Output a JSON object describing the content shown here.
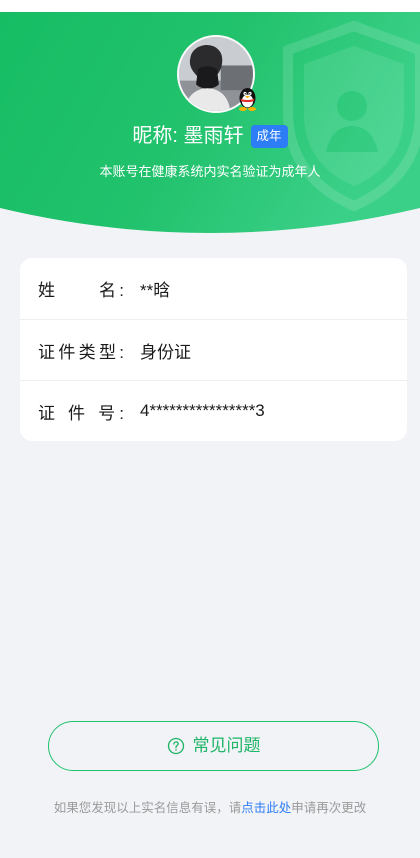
{
  "header": {
    "nickname": "昵称: 墨雨轩",
    "age_badge": "成年",
    "subtitle": "本账号在健康系统内实名验证为成年人",
    "avatar_icon": "user-avatar-photo",
    "platform_icon": "qq-penguin-icon",
    "watermark_icon": "shield-user-icon"
  },
  "info": {
    "rows": [
      {
        "label": "姓　　名:",
        "value": "**晗"
      },
      {
        "label": "证件类型:",
        "value": "身份证"
      },
      {
        "label": "证 件 号:",
        "value": "4****************3"
      }
    ]
  },
  "faq_button": {
    "label": "常见问题",
    "icon": "question-circle-icon"
  },
  "footer": {
    "prefix": "如果您发现以上实名信息有误，请",
    "link": "点击此处",
    "suffix": "申请再次更改"
  },
  "colors": {
    "primary_green": "#22c26d",
    "badge_blue": "#2d7df6",
    "link_blue": "#2d7df6",
    "page_bg": "#f2f3f7"
  }
}
